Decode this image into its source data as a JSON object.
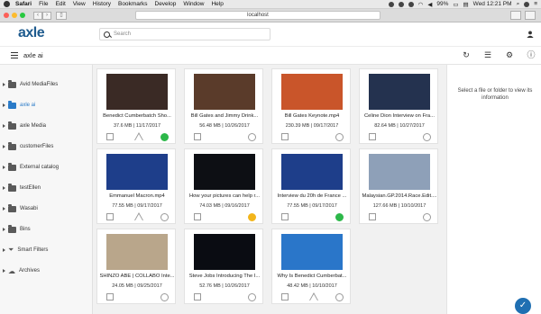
{
  "menubar": {
    "app": "Safari",
    "items": [
      "File",
      "Edit",
      "View",
      "History",
      "Bookmarks",
      "Develop",
      "Window",
      "Help"
    ],
    "battery": "99%",
    "clock": "Wed 12:21 PM"
  },
  "browser": {
    "url": "localhost"
  },
  "app": {
    "logo": "axle",
    "search_placeholder": "Search",
    "breadcrumb": "axle ai"
  },
  "sidebar": {
    "items": [
      {
        "label": "Avid MediaFiles"
      },
      {
        "label": "axle ai"
      },
      {
        "label": "axle Media"
      },
      {
        "label": "customerFiles"
      },
      {
        "label": "External catalog"
      },
      {
        "label": "testEllen"
      },
      {
        "label": "Wasabi"
      },
      {
        "label": "Bins"
      },
      {
        "label": "Smart Filters"
      },
      {
        "label": "Archives"
      }
    ]
  },
  "cards": [
    {
      "title": "Benedict Cumberbatch Sho...",
      "meta": "37.6 MB | 11/17/2017",
      "status": "green",
      "warn": true,
      "thumb_bg": "#3a2a25"
    },
    {
      "title": "Bill Gates and Jimmy Drink...",
      "meta": "56.48 MB | 10/26/2017",
      "status": "empty",
      "warn": false,
      "thumb_bg": "#5a3b2a"
    },
    {
      "title": "Bill Gates Keynote.mp4",
      "meta": "230.39 MB | 09/17/2017",
      "status": "empty",
      "warn": false,
      "thumb_bg": "#c9552a"
    },
    {
      "title": "Celine Dion Interview on Fra...",
      "meta": "82.64 MB | 10/27/2017",
      "status": "empty",
      "warn": false,
      "thumb_bg": "#24324f"
    },
    {
      "title": "Emmanuel Macron.mp4",
      "meta": "77.55 MB | 09/17/2017",
      "status": "empty",
      "warn": true,
      "thumb_bg": "#1e3e8a"
    },
    {
      "title": "How your pictures can help r...",
      "meta": "74.03 MB | 09/16/2017",
      "status": "yellow",
      "warn": false,
      "thumb_bg": "#0d0f14"
    },
    {
      "title": "Interview du 20h de France ...",
      "meta": "77.55 MB | 09/17/2017",
      "status": "green",
      "warn": false,
      "thumb_bg": "#1e3e8a"
    },
    {
      "title": "Malaysian.GP.2014.Race.Edit....",
      "meta": "127.66 MB | 10/10/2017",
      "status": "empty",
      "warn": false,
      "thumb_bg": "#8ea0b8"
    },
    {
      "title": "SHINZO ABE | COLLABO Inte...",
      "meta": "24.05 MB | 09/25/2017",
      "status": "empty",
      "warn": false,
      "thumb_bg": "#b9a68b"
    },
    {
      "title": "Steve Jobs Introducing The I...",
      "meta": "52.76 MB | 10/26/2017",
      "status": "empty",
      "warn": false,
      "thumb_bg": "#0a0c12"
    },
    {
      "title": "Why Is Benedict Cumberbat...",
      "meta": "48.42 MB | 10/10/2017",
      "status": "empty",
      "warn": true,
      "thumb_bg": "#2a76c9"
    }
  ],
  "info_panel": {
    "message": "Select a file or folder to view its information"
  },
  "icons": {
    "refresh": "refresh-icon",
    "list": "list-view-icon",
    "settings": "gear-icon",
    "info": "info-icon",
    "fab": "check-icon"
  }
}
